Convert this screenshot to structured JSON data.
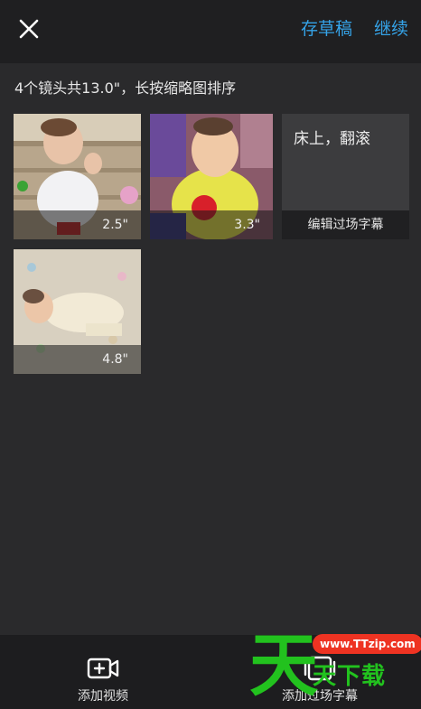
{
  "header": {
    "draft_label": "存草稿",
    "continue_label": "继续"
  },
  "summary": "4个镜头共13.0\"，长按缩略图排序",
  "clips": [
    {
      "duration": "2.5\""
    },
    {
      "duration": "3.3\""
    },
    {
      "subtitle_text": "床上，翻滚",
      "edit_label": "编辑过场字幕"
    },
    {
      "duration": "4.8\""
    }
  ],
  "bottom_bar": {
    "add_video_label": "添加视频",
    "add_subtitle_label": "添加过场字幕"
  },
  "watermark": {
    "big_char": "天",
    "url": "www.TTzip.com",
    "text": "天下载"
  },
  "colors": {
    "accent": "#35a3e8",
    "background": "#2a2a2c",
    "topbar": "#1f1f21",
    "watermark_green": "#22c21e",
    "watermark_red": "#ee3322"
  },
  "icons": {
    "close": "close-icon",
    "add_video": "video-plus-icon",
    "add_subtitle": "subtitle-card-icon"
  }
}
